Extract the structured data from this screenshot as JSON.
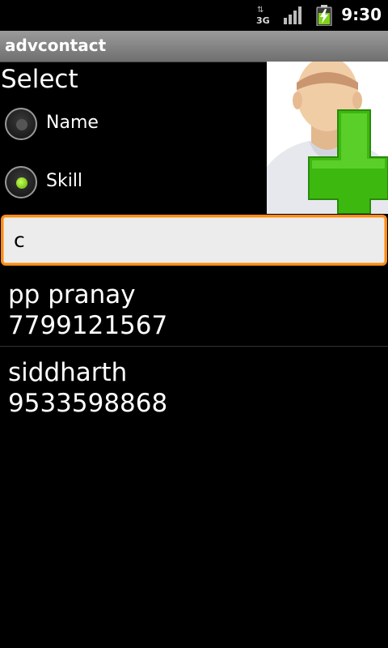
{
  "status_bar": {
    "network": "3G",
    "time": "9:30"
  },
  "app": {
    "title": "advcontact"
  },
  "search_mode": {
    "label": "Select",
    "options": [
      {
        "label": "Name",
        "selected": false
      },
      {
        "label": "Skill",
        "selected": true
      }
    ]
  },
  "search": {
    "value": "c"
  },
  "contacts": [
    {
      "name": "pp pranay",
      "phone": "7799121567"
    },
    {
      "name": "siddharth",
      "phone": "9533598868"
    }
  ],
  "colors": {
    "accent": "#f58c1d",
    "radio_selected": "#7fd21b",
    "add_icon": "#3cb80f",
    "title_bar": "#8a8a8a"
  },
  "icons": {
    "avatar": "person-add-icon"
  }
}
